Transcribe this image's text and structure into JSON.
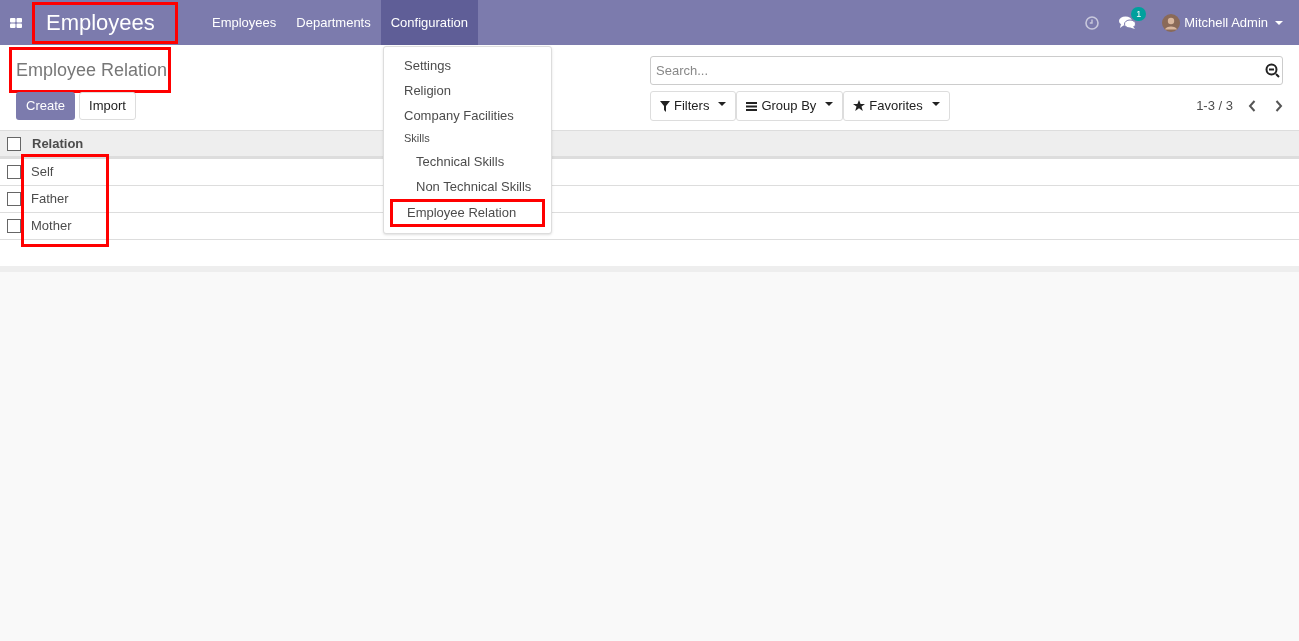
{
  "navbar": {
    "brand": "Employees",
    "brand_highlighted": true,
    "menu": [
      {
        "label": "Employees",
        "selected": false
      },
      {
        "label": "Departments",
        "selected": false
      },
      {
        "label": "Configuration",
        "selected": true
      }
    ],
    "message_count": "1",
    "user": "Mitchell Admin"
  },
  "dropdown": [
    {
      "kind": "item",
      "label": "Settings",
      "highlighted": false
    },
    {
      "kind": "item",
      "label": "Religion",
      "highlighted": false
    },
    {
      "kind": "item",
      "label": "Company Facilities",
      "highlighted": false
    },
    {
      "kind": "header",
      "label": "Skills",
      "highlighted": false
    },
    {
      "kind": "subitem",
      "label": "Technical Skills",
      "highlighted": false
    },
    {
      "kind": "subitem",
      "label": "Non Technical Skills",
      "highlighted": false
    },
    {
      "kind": "item",
      "label": "Employee Relation",
      "highlighted": true
    }
  ],
  "control_panel": {
    "title": "Employee Relation",
    "title_highlighted": true,
    "buttons": [
      "Create",
      "Import"
    ],
    "search": {
      "placeholder": "Search..."
    },
    "filters": [
      {
        "kind": "filter",
        "label": "Filters"
      },
      {
        "kind": "group",
        "label": "Group By"
      },
      {
        "kind": "star",
        "label": "Favorites"
      }
    ],
    "pager": "1-3 / 3"
  },
  "table": {
    "all_checked": false,
    "columns": [
      "Relation"
    ],
    "values_highlighted": true,
    "rows": [
      {
        "relation": "Self",
        "checked": false
      },
      {
        "relation": "Father",
        "checked": false
      },
      {
        "relation": "Mother",
        "checked": false
      }
    ]
  }
}
